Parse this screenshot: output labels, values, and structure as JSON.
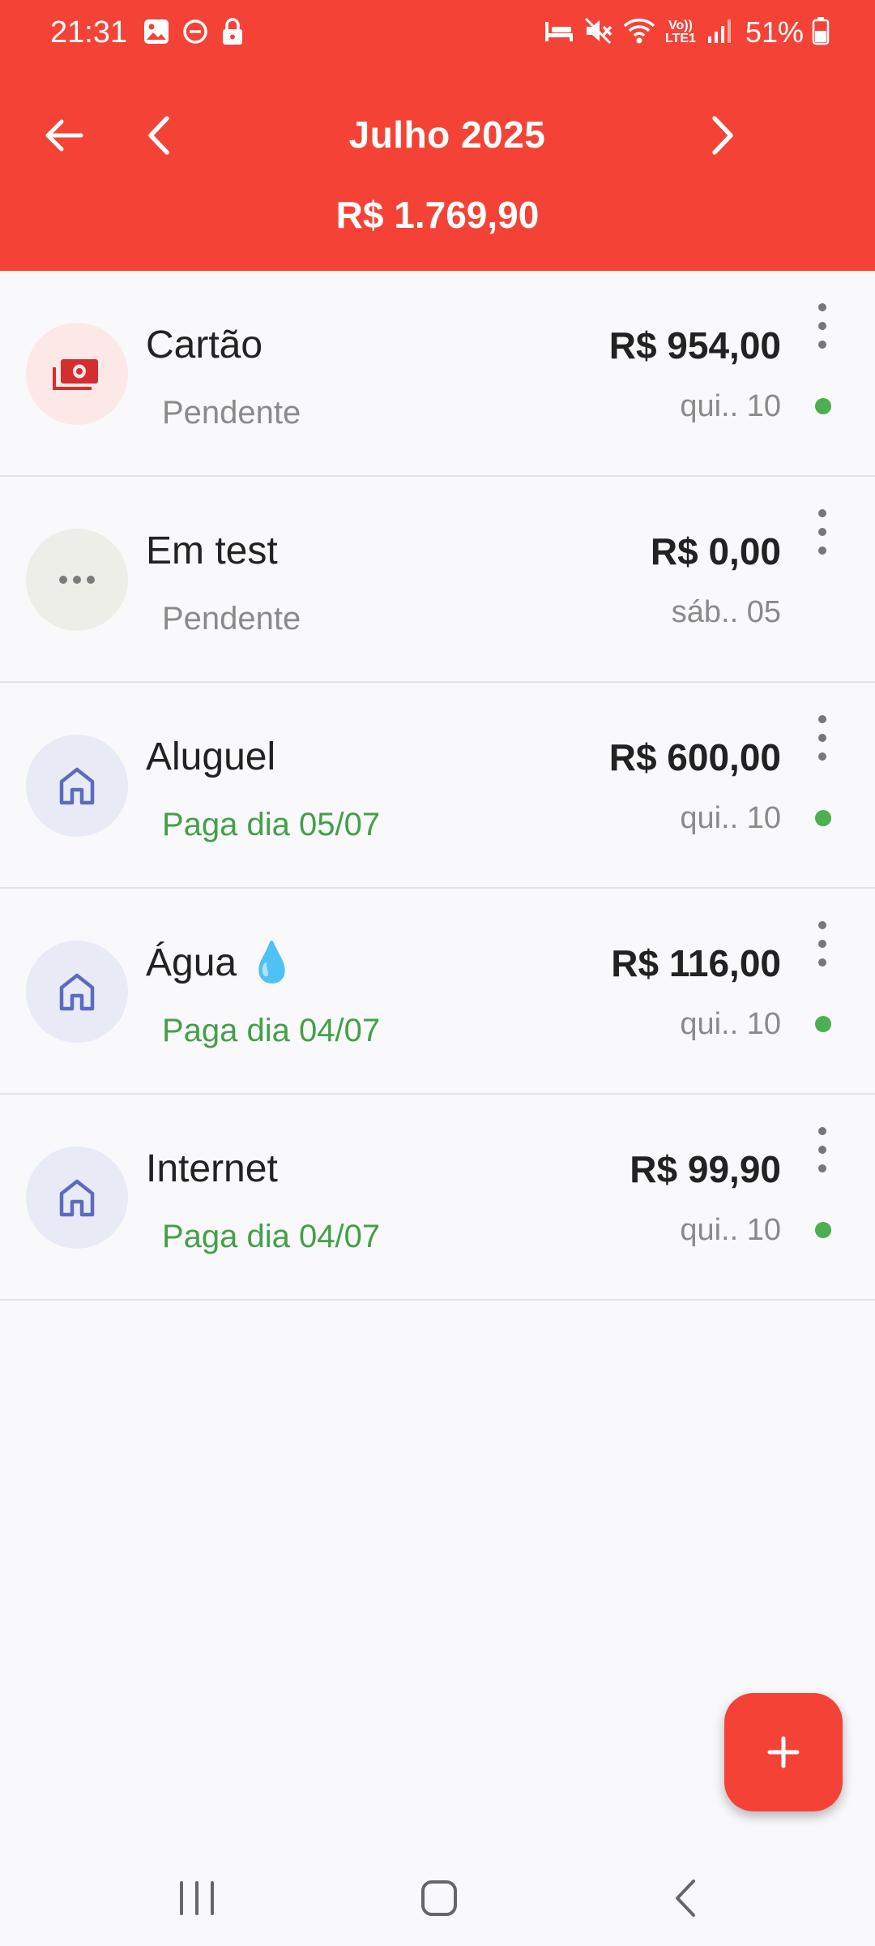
{
  "status_bar": {
    "time": "21:31",
    "battery": "51%",
    "left_icons": [
      "image-icon",
      "dnd-icon",
      "lock-icon"
    ],
    "right_icons": [
      "sleep-icon",
      "mute-icon",
      "wifi-icon",
      "volte-icon",
      "signal-icon",
      "battery-icon"
    ],
    "volte_label": "Vo)) LTE1"
  },
  "header": {
    "month": "Julho 2025",
    "total": "R$ 1.769,90",
    "color": "#f44336"
  },
  "bills": [
    {
      "name": "Cartão",
      "status": "Pendente",
      "status_type": "pending",
      "amount": "R$ 954,00",
      "date": "qui.. 10",
      "icon": "money-icon",
      "has_dot": true
    },
    {
      "name": "Em test",
      "status": "Pendente",
      "status_type": "pending",
      "amount": "R$ 0,00",
      "date": "sáb.. 05",
      "icon": "more-horizontal-icon",
      "has_dot": false
    },
    {
      "name": "Aluguel",
      "status": "Paga dia 05/07",
      "status_type": "paid",
      "amount": "R$ 600,00",
      "date": "qui.. 10",
      "icon": "home-icon",
      "has_dot": true
    },
    {
      "name": "Água 💧",
      "status": "Paga dia 04/07",
      "status_type": "paid",
      "amount": "R$ 116,00",
      "date": "qui.. 10",
      "icon": "home-icon",
      "has_dot": true
    },
    {
      "name": "Internet",
      "status": "Paga dia 04/07",
      "status_type": "paid",
      "amount": "R$ 99,90",
      "date": "qui.. 10",
      "icon": "home-icon",
      "has_dot": true
    }
  ],
  "fab": {
    "icon": "plus-icon"
  },
  "colors": {
    "paid": "#43a047",
    "pending": "#8a8a8a",
    "dot": "#4caf50"
  }
}
